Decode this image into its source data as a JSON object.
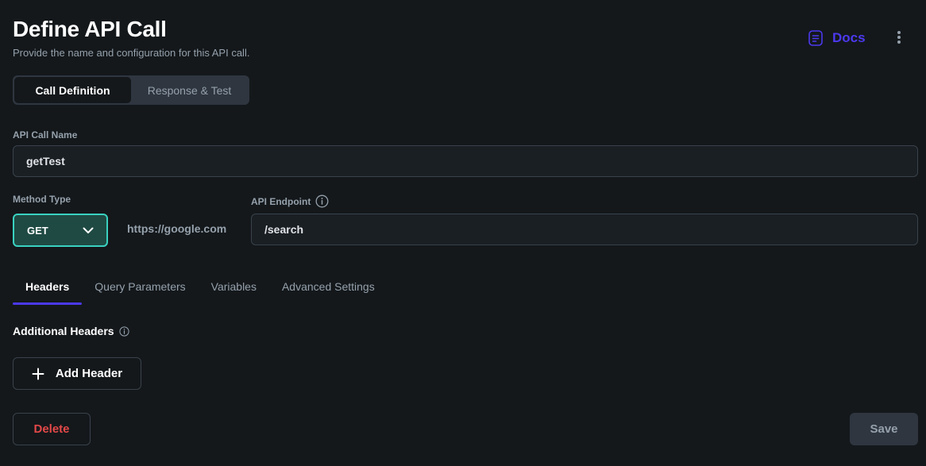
{
  "header": {
    "title": "Define API Call",
    "subtitle": "Provide the name and configuration for this API call.",
    "docs_label": "Docs",
    "docs_icon": "document-icon",
    "more_icon": "more-vertical-icon"
  },
  "mode_tabs": [
    {
      "label": "Call Definition",
      "active": true
    },
    {
      "label": "Response & Test",
      "active": false
    }
  ],
  "api_call_name": {
    "label": "API Call Name",
    "value": "getTest"
  },
  "method_type": {
    "label": "Method Type",
    "value": "GET"
  },
  "base_url": "https://google.com",
  "api_endpoint": {
    "label": "API Endpoint",
    "value": "/search",
    "info_icon": "info-icon"
  },
  "config_tabs": [
    {
      "label": "Headers",
      "active": true
    },
    {
      "label": "Query Parameters",
      "active": false
    },
    {
      "label": "Variables",
      "active": false
    },
    {
      "label": "Advanced Settings",
      "active": false
    }
  ],
  "headers_section": {
    "title": "Additional Headers",
    "add_button_label": "Add Header"
  },
  "footer": {
    "delete_label": "Delete",
    "save_label": "Save"
  },
  "colors": {
    "background": "#14181b",
    "accent": "#4b39ef",
    "method_accent": "#39d2c0",
    "danger": "#e34848",
    "secondary_text": "#95a1ac"
  }
}
